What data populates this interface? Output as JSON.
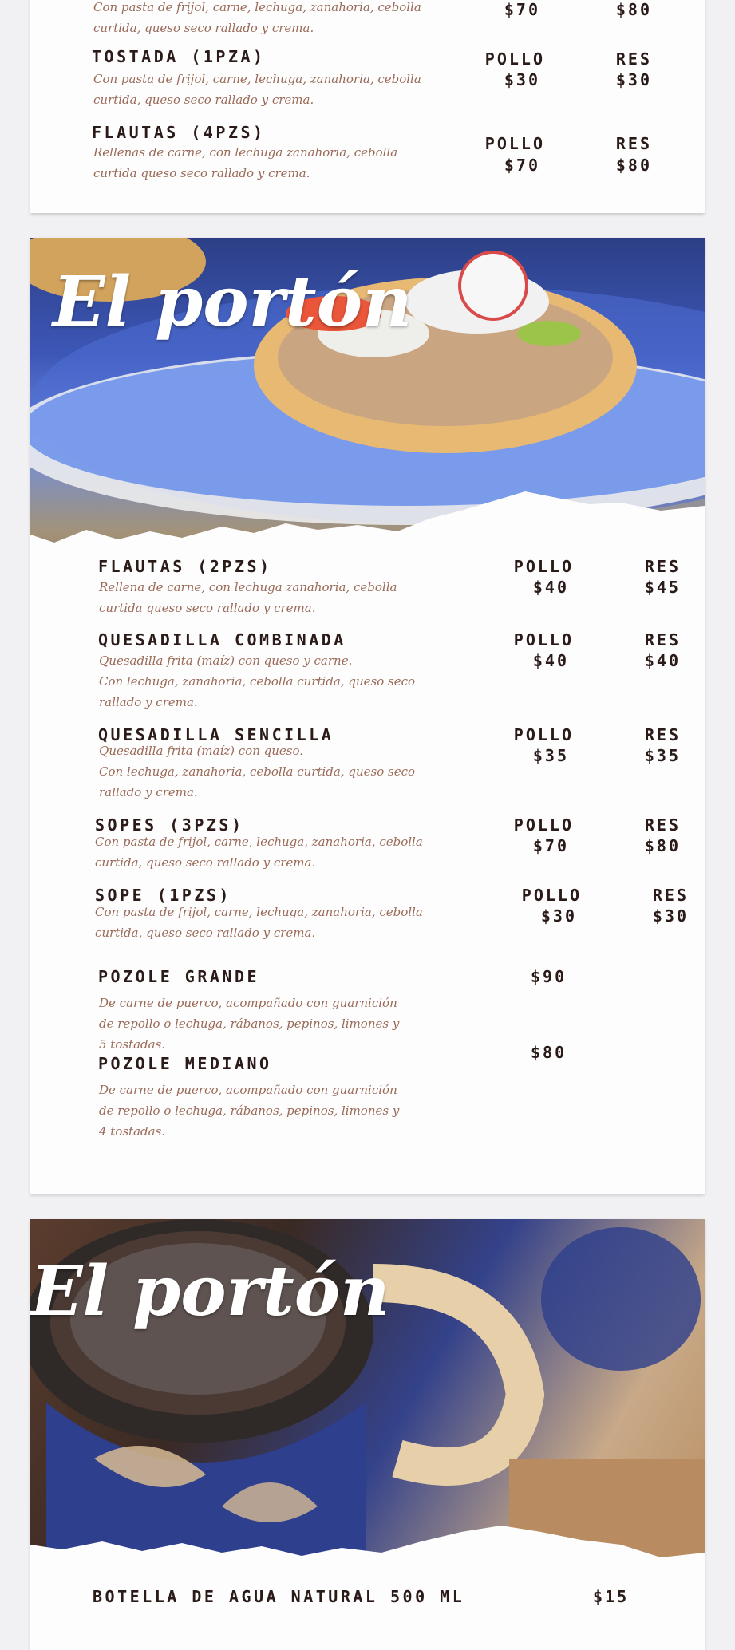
{
  "card1": {
    "items": [
      {
        "name": "",
        "desc": "Con pasta de frijol, carne, lechuga, zanahoria, cebolla\ncurtida, queso seco rallado y crema.",
        "labels": [
          "",
          ""
        ],
        "prices": [
          "$70",
          "$80"
        ]
      },
      {
        "name": "TOSTADA (1PZA)",
        "desc": "Con pasta de frijol, carne, lechuga, zanahoria, cebolla\ncurtida, queso seco rallado y crema.",
        "labels": [
          "POLLO",
          "RES"
        ],
        "prices": [
          "$30",
          "$30"
        ]
      },
      {
        "name": "FLAUTAS (4PZS)",
        "desc": "Rellenas de carne, con lechuga zanahoria, cebolla\ncurtida queso seco rallado y crema.",
        "labels": [
          "POLLO",
          "RES"
        ],
        "prices": [
          "$70",
          "$80"
        ]
      }
    ]
  },
  "card2": {
    "brand": "El portón",
    "items": [
      {
        "name": "FLAUTAS  (2PZS)",
        "desc": "Rellena de carne, con lechuga zanahoria, cebolla\ncurtida queso seco rallado y crema.",
        "labels": [
          "POLLO",
          "RES"
        ],
        "prices": [
          "$40",
          "$45"
        ]
      },
      {
        "name": "QUESADILLA COMBINADA",
        "desc": "Quesadilla frita (maíz) con queso y carne.\nCon lechuga, zanahoria, cebolla curtida, queso seco\nrallado y crema.",
        "labels": [
          "POLLO",
          "RES"
        ],
        "prices": [
          "$40",
          "$40"
        ]
      },
      {
        "name": "QUESADILLA SENCILLA",
        "desc": "Quesadilla frita (maíz) con queso.\nCon lechuga, zanahoria, cebolla curtida, queso seco\nrallado y crema.",
        "labels": [
          "POLLO",
          "RES"
        ],
        "prices": [
          "$35",
          "$35"
        ]
      },
      {
        "name": "SOPES (3PZS)",
        "desc": "Con pasta de frijol, carne, lechuga, zanahoria, cebolla\ncurtida, queso seco rallado y crema.",
        "labels": [
          "POLLO",
          "RES"
        ],
        "prices": [
          "$70",
          "$80"
        ]
      },
      {
        "name": "SOPE  (1PZS)",
        "desc": "Con pasta de frijol, carne, lechuga, zanahoria, cebolla\ncurtida, queso seco rallado y crema.",
        "labels": [
          "POLLO",
          "RES"
        ],
        "prices": [
          "$30",
          "$30"
        ]
      },
      {
        "name": "POZOLE GRANDE",
        "desc": "De carne de puerco, acompañado con guarnición\nde repollo o lechuga, rábanos, pepinos, limones y\n5 tostadas.",
        "labels": [
          "",
          ""
        ],
        "prices": [
          "$90",
          ""
        ]
      },
      {
        "name": "POZOLE MEDIANO",
        "desc": "De carne de puerco, acompañado con guarnición\nde repollo o lechuga, rábanos, pepinos, limones y\n4 tostadas.",
        "labels": [
          "",
          ""
        ],
        "prices": [
          "$80",
          ""
        ]
      }
    ]
  },
  "card3": {
    "brand": "El portón",
    "items": [
      {
        "name": "BOTELLA DE AGUA NATURAL 500 ML",
        "price": "$15"
      }
    ]
  }
}
